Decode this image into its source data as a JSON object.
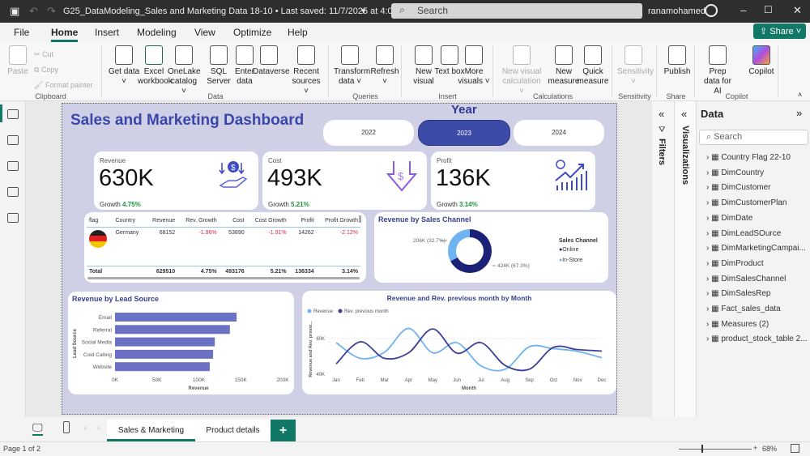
{
  "titlebar": {
    "title": "G25_DataModeling_Sales and Marketing Data 18-10 • Last saved: 11/7/2025 at 4:02 AM",
    "search_placeholder": "Search",
    "user": "ranamohamed"
  },
  "menu": {
    "items": [
      "File",
      "Home",
      "Insert",
      "Modeling",
      "View",
      "Optimize",
      "Help"
    ],
    "active": "Home",
    "share": "Share"
  },
  "ribbon": {
    "groups": [
      "Clipboard",
      "Data",
      "Queries",
      "Insert",
      "Calculations",
      "Sensitivity",
      "Share",
      "Copilot"
    ],
    "clipboard": {
      "paste": "Paste",
      "cut": "Cut",
      "copy": "Copy",
      "format_painter": "Format painter"
    },
    "buttons": [
      {
        "label": "Get data ˅",
        "icon": "database-icon"
      },
      {
        "label": "Excel workbook",
        "icon": "excel-icon"
      },
      {
        "label": "OneLake catalog ˅",
        "icon": "onelake-icon"
      },
      {
        "label": "SQL Server",
        "icon": "sql-server-icon"
      },
      {
        "label": "Enter data",
        "icon": "table-icon"
      },
      {
        "label": "Dataverse",
        "icon": "dataverse-icon"
      },
      {
        "label": "Recent sources ˅",
        "icon": "recent-sources-icon"
      },
      {
        "label": "Transform data ˅",
        "icon": "transform-icon"
      },
      {
        "label": "Refresh ˅",
        "icon": "refresh-icon"
      },
      {
        "label": "New visual",
        "icon": "new-visual-icon"
      },
      {
        "label": "Text box",
        "icon": "text-box-icon"
      },
      {
        "label": "More visuals ˅",
        "icon": "more-visuals-icon"
      },
      {
        "label": "New visual calculation ˅",
        "icon": "visual-calculation-icon",
        "disabled": true
      },
      {
        "label": "New measure",
        "icon": "calculator-icon"
      },
      {
        "label": "Quick measure",
        "icon": "quick-measure-icon"
      },
      {
        "label": "Sensitivity ˅",
        "icon": "sensitivity-icon",
        "disabled": true
      },
      {
        "label": "Publish",
        "icon": "publish-icon"
      },
      {
        "label": "Prep data for AI",
        "icon": "prep-data-icon"
      },
      {
        "label": "Copilot",
        "icon": "copilot-icon"
      }
    ]
  },
  "dashboard": {
    "title": "Sales and Marketing Dashboard",
    "year_label": "Year",
    "years": [
      "2022",
      "2023",
      "2024"
    ],
    "selected_year": "2023",
    "kpis": [
      {
        "label": "Revenue",
        "value": "630K",
        "growth_label": "Growth",
        "growth": "4.75%",
        "icon": "money-hand-icon"
      },
      {
        "label": "Cost",
        "value": "493K",
        "growth_label": "Growth",
        "growth": "5.21%",
        "icon": "cost-down-icon"
      },
      {
        "label": "Profit",
        "value": "136K",
        "growth_label": "Growth",
        "growth": "3.14%",
        "icon": "profit-growth-icon"
      }
    ],
    "table": {
      "headers": [
        "flag",
        "Country",
        "Revenue",
        "Rev. Growth",
        "Cost",
        "Cost Growth",
        "Profit",
        "Profit Growth"
      ],
      "rows": [
        [
          "",
          "Germany",
          "68152",
          "-1.96%",
          "53890",
          "-1.91%",
          "14262",
          "-2.12%"
        ]
      ],
      "total": [
        "Total",
        "",
        "629510",
        "4.75%",
        "493176",
        "5.21%",
        "136334",
        "3.14%"
      ]
    }
  },
  "chart_data": [
    {
      "type": "pie",
      "title": "Revenue by Sales Channel",
      "legend_title": "Sales Channel",
      "legend_position": "right",
      "categories": [
        "Online",
        "In-Store"
      ],
      "values": [
        424,
        206
      ],
      "labels": [
        "424K (67.3%)",
        "206K (32.7%)"
      ],
      "colors": [
        "#1b2176",
        "#6fb3f0"
      ]
    },
    {
      "type": "bar",
      "title": "Revenue by Lead Source",
      "xlabel": "Revenue",
      "ylabel": "Lead Source",
      "categories": [
        "Email",
        "Referral",
        "Social Media",
        "Cold Calling",
        "Website"
      ],
      "values": [
        145,
        137,
        119,
        117,
        113
      ],
      "xlim": [
        0,
        200
      ],
      "xticks": [
        "0K",
        "50K",
        "100K",
        "150K",
        "200K"
      ],
      "color": "#6b72c4"
    },
    {
      "type": "line",
      "title": "Revenue and Rev. previous month by Month",
      "xlabel": "Month",
      "ylabel": "Revenue and Rev. previo...",
      "x": [
        "Jan",
        "Feb",
        "Mar",
        "Apr",
        "May",
        "Jun",
        "Jul",
        "Aug",
        "Sep",
        "Oct",
        "Nov",
        "Dec"
      ],
      "ylim": [
        40,
        70
      ],
      "yticks": [
        "40K",
        "60K"
      ],
      "series": [
        {
          "name": "Revenue",
          "color": "#6fb3f0",
          "values": [
            57.7,
            48.9,
            52.3,
            65.7,
            52.0,
            57.7,
            44.6,
            42.8,
            55.4,
            54.3,
            52.8,
            49.2
          ]
        },
        {
          "name": "Rev. previous month",
          "color": "#3b3f95",
          "values": [
            45.8,
            58.2,
            48.9,
            52.0,
            65.4,
            51.8,
            57.7,
            44.9,
            42.8,
            55.1,
            53.8,
            53.0
          ]
        }
      ]
    }
  ],
  "panes": {
    "filters": "Filters",
    "visualizations": "Visualizations",
    "data_title": "Data",
    "search_placeholder": "Search",
    "tables": [
      "Country Flag 22-10",
      "DimCountry",
      "DimCustomer",
      "DimCustomerPlan",
      "DimDate",
      "DimLeadSOurce",
      "DimMarketingCampai...",
      "DimProduct",
      "DimSalesChannel",
      "DimSalesRep",
      "Fact_sales_data",
      "Measures (2)",
      "product_stock_table 2..."
    ]
  },
  "pages": {
    "tabs": [
      "Sales & Marketing",
      "Product details"
    ],
    "active": "Sales & Marketing",
    "add": "+"
  },
  "status": {
    "page": "Page 1 of 2",
    "zoom": "68%"
  }
}
